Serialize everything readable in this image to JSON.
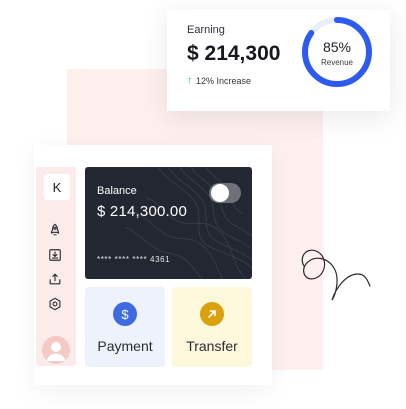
{
  "earning": {
    "title": "Earning",
    "amount": "$ 214,300",
    "trend_text": "12% Increase",
    "trend_direction": "up",
    "revenue_percent_text": "85%",
    "revenue_percent": 85,
    "revenue_label": "Revenue",
    "ring_color": "#2d5bef",
    "ring_track_color": "#e9eefb"
  },
  "sidebar": {
    "logo_letter": "K",
    "items": [
      {
        "icon": "rocket-icon"
      },
      {
        "icon": "download-icon"
      },
      {
        "icon": "upload-icon"
      },
      {
        "icon": "settings-icon"
      }
    ],
    "avatar": "user-avatar"
  },
  "balance_card": {
    "label": "Balance",
    "amount": "$ 214,300.00",
    "card_number": "**** **** **** 4361",
    "background": "#222731"
  },
  "actions": [
    {
      "label": "Payment",
      "icon": "dollar-icon",
      "color": "#3f6ae0"
    },
    {
      "label": "Transfer",
      "icon": "arrow-up-right-icon",
      "color": "#d9a10c"
    }
  ]
}
